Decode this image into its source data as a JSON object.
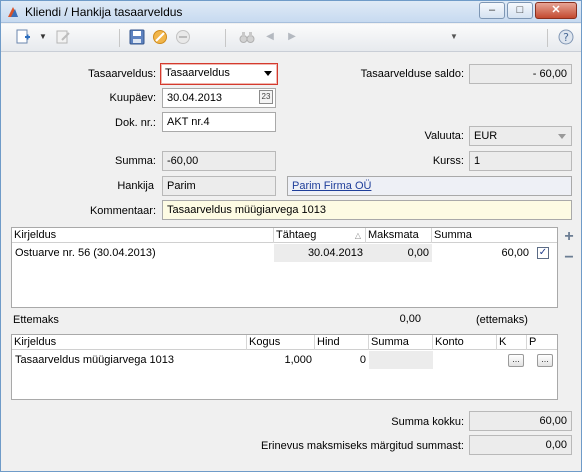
{
  "window": {
    "title": "Kliendi / Hankija tasaarveldus",
    "min_label": "–",
    "max_label": "□",
    "close_label": "✕"
  },
  "toolbar": {
    "icons": [
      "add-document-icon",
      "dropdown-arrow-icon",
      "edit-icon",
      "save-icon",
      "cancel-icon",
      "remove-icon",
      "binoculars-icon",
      "prev-icon",
      "next-icon",
      "menu-arrow-icon",
      "help-icon"
    ]
  },
  "form": {
    "tasaarveldus_label": "Tasaarveldus:",
    "tasaarveldus_value": "Tasaarveldus",
    "saldo_label": "Tasaarvelduse saldo:",
    "saldo_value": "- 60,00",
    "kuupaev_label": "Kuupäev:",
    "kuupaev_value": "30.04.2013",
    "calendar_icon_text": "23",
    "doknr_label": "Dok. nr.:",
    "doknr_value": "AKT nr.4",
    "valuuta_label": "Valuuta:",
    "valuuta_value": "EUR",
    "summa_label": "Summa:",
    "summa_value": "-60,00",
    "kurss_label": "Kurss:",
    "kurss_value": "1",
    "hankija_label": "Hankija",
    "hankija_code": "Parim",
    "hankija_name": "Parim Firma OÜ",
    "kommentaar_label": "Kommentaar:",
    "kommentaar_value": "Tasaarveldus müügiarvega 1013"
  },
  "grid1": {
    "headers": [
      "Kirjeldus",
      "Tähtaeg",
      "Maksmata",
      "Summa"
    ],
    "sort_indicator": "△",
    "rows": [
      {
        "kirjeldus": "Ostuarve nr. 56 (30.04.2013)",
        "tahtaeg": "30.04.2013",
        "maksmata": "0,00",
        "summa": "60,00",
        "checked": "✓"
      }
    ]
  },
  "ettemaks": {
    "label": "Ettemaks",
    "value": "0,00",
    "note": "(ettemaks)"
  },
  "grid2": {
    "headers": [
      "Kirjeldus",
      "Kogus",
      "Hind",
      "Summa",
      "Konto",
      "K",
      "P"
    ],
    "rows": [
      {
        "kirjeldus": "Tasaarveldus müügiarvega 1013",
        "kogus": "1,000",
        "hind": "0",
        "summa": "",
        "konto": "",
        "k_btn": "...",
        "p_btn": "..."
      }
    ]
  },
  "side": {
    "plus": "+",
    "minus": "−"
  },
  "footer": {
    "summa_kokku_label": "Summa kokku:",
    "summa_kokku_value": "60,00",
    "erinevus_label": "Erinevus maksmiseks märgitud summast:",
    "erinevus_value": "0,00"
  }
}
